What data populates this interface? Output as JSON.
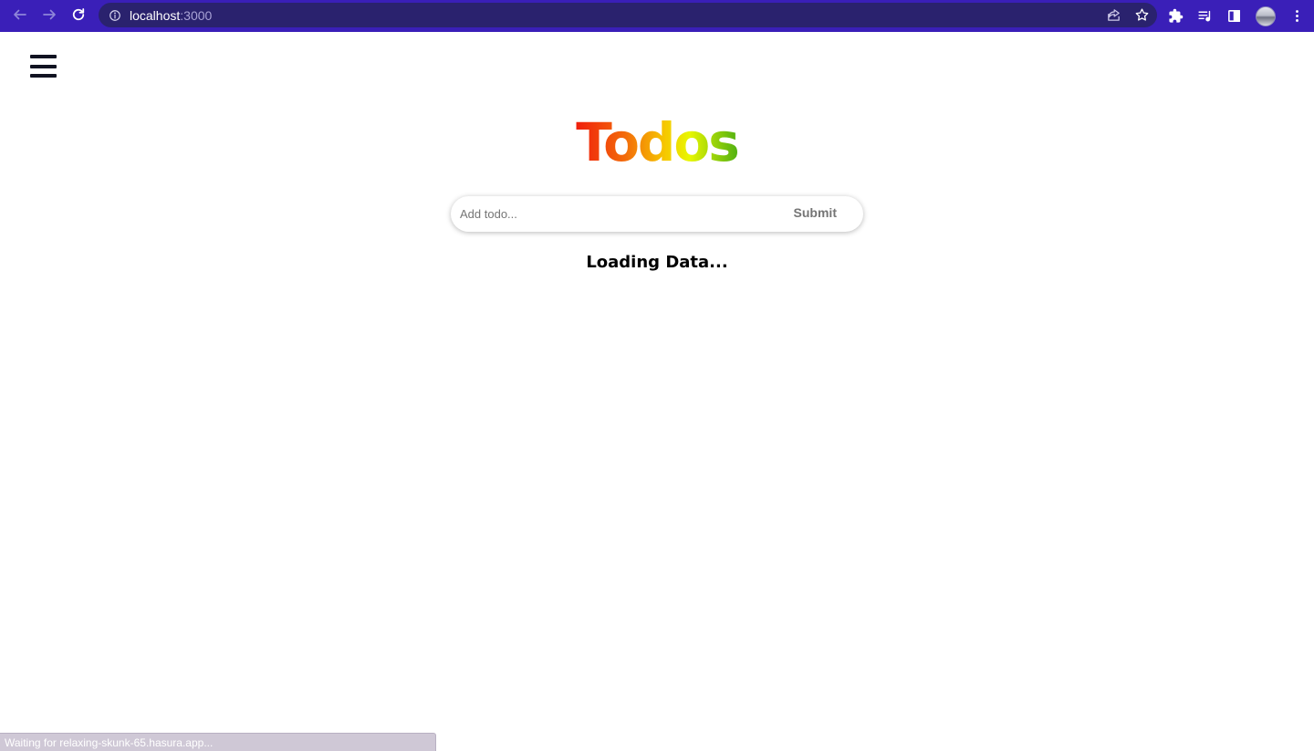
{
  "browser": {
    "url_host": "localhost",
    "url_port": ":3000",
    "status_text": "Waiting for relaxing-skunk-65.hasura.app..."
  },
  "colors": {
    "chrome": "#3a1fb8",
    "omnibox": "#2a226e",
    "title_gradient": [
      "#f01e0c",
      "#f36a0a",
      "#f6c800",
      "#e8f700",
      "#4fb012"
    ]
  },
  "page": {
    "title": "Todos",
    "input_placeholder": "Add todo...",
    "input_value": "",
    "submit_label": "Submit",
    "loading_text": "Loading Data..."
  },
  "icons": {
    "back": "arrow-left-icon",
    "forward": "arrow-right-icon",
    "reload": "reload-icon",
    "info": "info-icon",
    "share": "share-icon",
    "bookmark": "star-icon",
    "extensions": "puzzle-icon",
    "media": "media-queue-icon",
    "side_panel": "side-panel-icon",
    "profile": "avatar",
    "menu": "kebab-menu-icon",
    "hamburger": "hamburger-icon"
  }
}
